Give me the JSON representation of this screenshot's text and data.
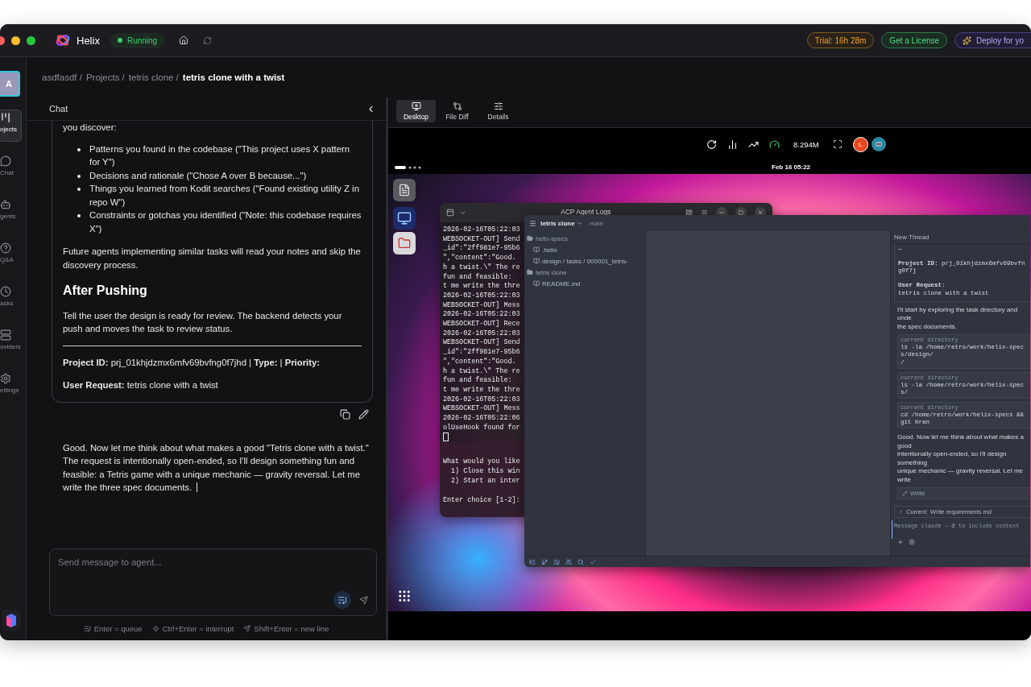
{
  "app": {
    "name": "Helix",
    "status": "Running"
  },
  "header_actions": [
    {
      "kind": "trial",
      "label": "Trial: 16h 28m"
    },
    {
      "kind": "license",
      "label": "Get a License"
    },
    {
      "kind": "deploy",
      "label": "Deploy for yo"
    }
  ],
  "sidebar": {
    "avatar": "A",
    "items": [
      {
        "kind": "projects",
        "label": "ojects",
        "selected": true
      },
      {
        "kind": "chat",
        "label": "Chat",
        "selected": false
      },
      {
        "kind": "agents",
        "label": "gents",
        "selected": false
      },
      {
        "kind": "qa",
        "label": "Q&A",
        "selected": false
      },
      {
        "kind": "tasks",
        "label": "asks",
        "selected": false
      },
      {
        "kind": "providers",
        "label": "oviders",
        "selected": false
      },
      {
        "kind": "settings",
        "label": "ettings",
        "selected": false
      }
    ]
  },
  "breadcrumb": [
    "asdfasdf /",
    "Projects /",
    "tetris clone /",
    "tetris clone with a twist"
  ],
  "chat": {
    "title": "Chat",
    "message": {
      "intro": "you discover:",
      "bullets": [
        "Patterns you found in the codebase (\"This project uses X pattern for Y\")",
        "Decisions and rationale (\"Chose A over B because...\")",
        "Things you learned from Kodit searches (\"Found existing utility Z in repo W\")",
        "Constraints or gotchas you identified (\"Note: this codebase requires X\")"
      ],
      "closing": "Future agents implementing similar tasks will read your notes and skip the discovery process.",
      "heading": "After Pushing",
      "body": "Tell the user the design is ready for review. The backend detects your push and moves the task to review status.",
      "meta": [
        "**Project ID:** prj_01khjdzmx6mfv69bvfng0f7jhd | **Type:** | **Priority:**",
        "**User Request:** tetris clone with a twist"
      ]
    },
    "reply": "Good. Now let me think about what makes a good \"Tetris clone with a twist.\" The request is intentionally open-ended, so I'll design something fun and feasible: a Tetris game with a unique mechanic — gravity reversal. Let me write the three spec documents.",
    "input": {
      "placeholder": "Send message to agent..."
    },
    "hints": [
      {
        "kind": "queue",
        "label": "Enter = queue"
      },
      {
        "kind": "interrupt",
        "label": "Ctrl+Enter = interrupt"
      },
      {
        "kind": "newline",
        "label": "Shift+Enter = new line"
      }
    ]
  },
  "viewer": {
    "tabs": [
      {
        "kind": "desktop",
        "label": "Desktop",
        "selected": true
      },
      {
        "kind": "diff",
        "label": "File Diff",
        "selected": false
      },
      {
        "kind": "details",
        "label": "Details",
        "selected": false
      }
    ],
    "bitrate": "8.294M",
    "user_initial": "L",
    "clock": "Feb 16 05:22"
  },
  "terminal": {
    "title": "ACP Agent Logs",
    "log": [
      "2026-02-16T05:22:03",
      "WEBSOCKET-OUT] Send",
      "_id\":\"2ff981e7-95b6",
      "\",\"content\":\"Good.",
      "h a twist.\\\" The re",
      "fun and feasible:",
      "t me write the thre",
      "2026-02-16T05:22:03",
      "WEBSOCKET-OUT] Mess",
      "2026-02-16T05:22:03",
      "WEBSOCKET-OUT] Rece",
      "2026-02-16T05:22:03",
      "WEBSOCKET-OUT] Send",
      "_id\":\"2ff981e7-95b6",
      "\",\"content\":\"Good.",
      "h a twist.\\\" The re",
      "fun and feasible:",
      "t me write the thre",
      "2026-02-16T05:22:03",
      "WEBSOCKET-OUT] Mess",
      "2026-02-16T05:22:06",
      "olUseHook found for"
    ],
    "prompt": {
      "menu": [
        "What would you like",
        "  1) Close this win",
        "  2) Start an inter"
      ],
      "entry": "Enter choice [1-2]:"
    }
  },
  "editor": {
    "project": "tetris clone",
    "branch": "main",
    "tree": [
      {
        "label": "helix-specs",
        "children": [
          {
            "label": ".helix"
          },
          {
            "label": "design / tasks / 000001_tetris-"
          }
        ]
      },
      {
        "label": "tetris clone",
        "children": [
          {
            "label": "README.md"
          }
        ]
      }
    ]
  },
  "thread": {
    "title": "New Thread",
    "quote": [
      "—",
      "**Project ID:** prj_01khjdzmx6mfv69bvfng0f7j",
      "**User Request:**",
      "tetris clone with a twist"
    ],
    "intro": [
      "I'll start by exploring the task directory and unde",
      "the spec documents."
    ],
    "tools": [
      {
        "label": "current directory",
        "lines": [
          "ls -la /home/retro/work/helix-specs/design/",
          "/"
        ]
      },
      {
        "label": "current directory",
        "lines": [
          "ls -la /home/retro/work/helix-specs/"
        ]
      },
      {
        "label": "current directory",
        "lines": [
          "cd /home/retro/work/helix-specs && git bran"
        ]
      }
    ],
    "reply": [
      "Good. Now let me think about what makes a good",
      "intentionally open-ended, so I'll design something",
      "unique mechanic — gravity reversal. Let me write"
    ],
    "write_label": "Write",
    "current": {
      "label": "Current:",
      "value": "Write requirements.md"
    },
    "input": {
      "placeholder": "Message claude — @ to include context"
    }
  }
}
